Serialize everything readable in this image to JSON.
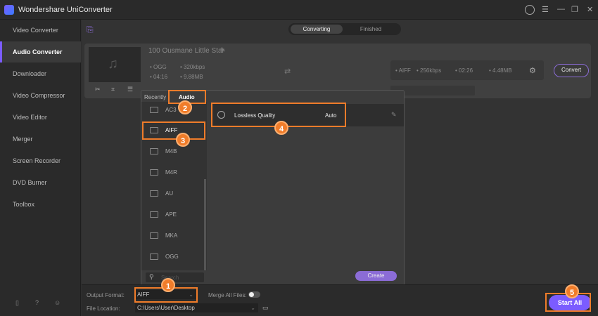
{
  "app": {
    "title": "Wondershare UniConverter"
  },
  "sidebar": {
    "items": [
      {
        "label": "Video Converter"
      },
      {
        "label": "Audio Converter"
      },
      {
        "label": "Downloader"
      },
      {
        "label": "Video Compressor"
      },
      {
        "label": "Video Editor"
      },
      {
        "label": "Merger"
      },
      {
        "label": "Screen Recorder"
      },
      {
        "label": "DVD Burner"
      },
      {
        "label": "Toolbox"
      }
    ]
  },
  "tabs": {
    "converting": "Converting",
    "finished": "Finished"
  },
  "file": {
    "name": "100 Ousmane Little Star",
    "format": "OGG",
    "bitrate": "320kbps",
    "duration": "04:16",
    "size": "9.88MB"
  },
  "target": {
    "format": "AIFF",
    "bitrate": "256kbps",
    "duration": "02:26",
    "size": "4.48MB",
    "convert": "Convert"
  },
  "popup": {
    "tab_recently": "Recently",
    "tab_audio": "Audio",
    "formats": [
      "AC3",
      "AIFF",
      "M4B",
      "M4R",
      "AU",
      "APE",
      "MKA",
      "OGG"
    ],
    "quality": "Lossless Quality",
    "quality_value": "Auto",
    "search_placeholder": "Search",
    "create": "Create"
  },
  "bottom": {
    "output_format_label": "Output Format:",
    "output_format": "AIFF",
    "merge_label": "Merge All Files:",
    "file_location_label": "File Location:",
    "file_location": "C:\\Users\\User\\Desktop",
    "start_all": "Start All"
  },
  "steps": [
    "1",
    "2",
    "3",
    "4",
    "5"
  ]
}
